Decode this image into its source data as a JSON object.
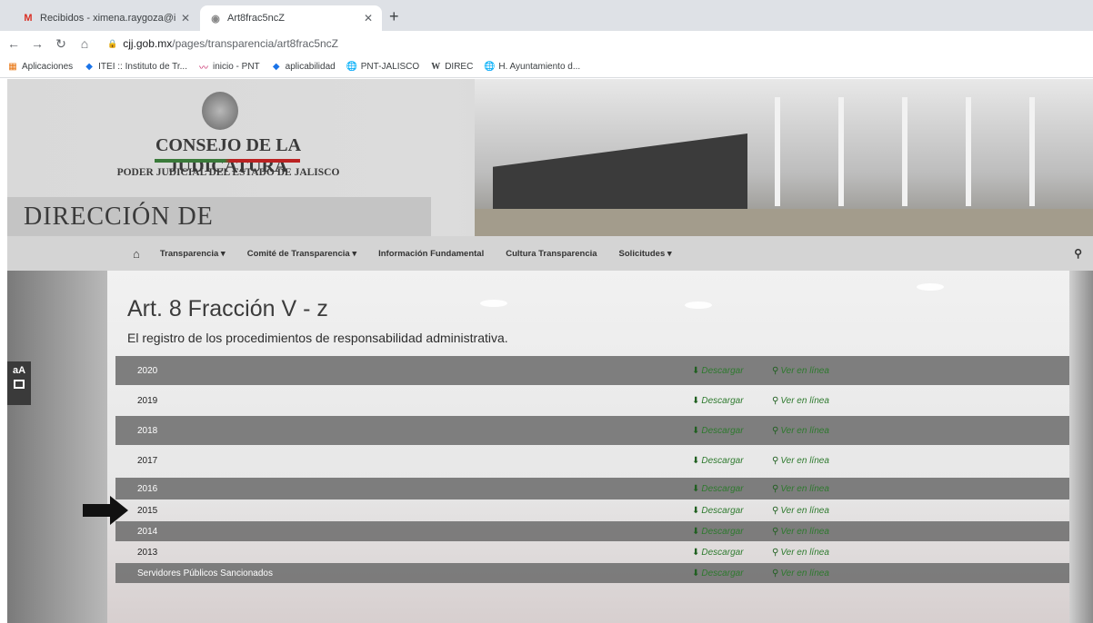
{
  "browser": {
    "tabs": [
      {
        "title": "Recibidos - ximena.raygoza@ite"
      },
      {
        "title": "Art8frac5ncZ"
      }
    ],
    "address": {
      "host": "cjj.gob.mx",
      "path": "/pages/transparencia/art8frac5ncZ"
    },
    "bookmarks": [
      {
        "label": "Aplicaciones",
        "icon": "apps-grid-icon"
      },
      {
        "label": "ITEI :: Instituto de Tr...",
        "icon": "itei-icon"
      },
      {
        "label": "inicio - PNT",
        "icon": "pnt-icon"
      },
      {
        "label": "aplicabilidad",
        "icon": "itei-icon"
      },
      {
        "label": "PNT-JALISCO",
        "icon": "globe-icon"
      },
      {
        "label": "DIREC",
        "icon": "wikipedia-icon"
      },
      {
        "label": "H. Ayuntamiento d...",
        "icon": "globe-icon"
      }
    ]
  },
  "header": {
    "institution": "CONSEJO DE LA JUDICATURA",
    "subinstitution": "PODER JUDICIAL DEL ESTADO DE JALISCO",
    "department": "DIRECCIÓN DE TRANSPARENCIA"
  },
  "nav": {
    "items": [
      {
        "label": "Transparencia ▾"
      },
      {
        "label": "Comité de Transparencia ▾"
      },
      {
        "label": "Información Fundamental"
      },
      {
        "label": "Cultura Transparencia"
      },
      {
        "label": "Solicitudes ▾"
      }
    ]
  },
  "page": {
    "title": "Art. 8 Fracción V - z",
    "subtitle": "El registro de los procedimientos de responsabilidad administrativa."
  },
  "accessibility": {
    "font_toggle": "aA"
  },
  "rows": [
    {
      "label": "2020",
      "download": "Descargar",
      "view": "Ver en línea"
    },
    {
      "label": "2019",
      "download": "Descargar",
      "view": "Ver en línea"
    },
    {
      "label": "2018",
      "download": "Descargar",
      "view": "Ver en línea"
    },
    {
      "label": "2017",
      "download": "Descargar",
      "view": "Ver en línea"
    },
    {
      "label": "2016",
      "download": "Descargar",
      "view": "Ver en línea"
    },
    {
      "label": "2015",
      "download": "Descargar",
      "view": "Ver en línea"
    },
    {
      "label": "2014",
      "download": "Descargar",
      "view": "Ver en línea"
    },
    {
      "label": "2013",
      "download": "Descargar",
      "view": "Ver en línea"
    },
    {
      "label": "Servidores Públicos Sancionados",
      "download": "Descargar",
      "view": "Ver en línea"
    }
  ],
  "colors": {
    "accent_green": "#2e7a2e",
    "row_dark": "#6e6e6e"
  }
}
